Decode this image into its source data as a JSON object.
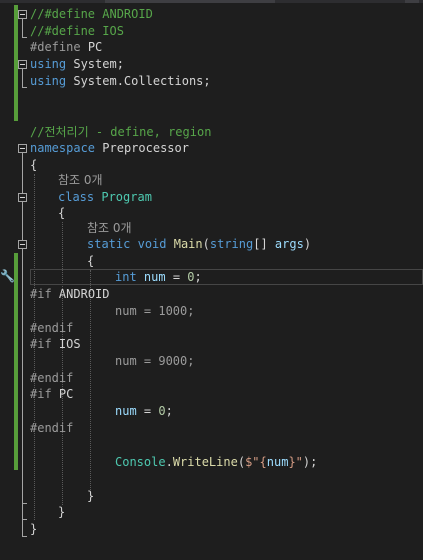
{
  "editor": {
    "lines": {
      "l1": "//#define ANDROID",
      "l2": "//#define IOS",
      "l3_directive": "#define",
      "l3_symbol": "PC",
      "l4_kw": "using",
      "l4_rest": "System;",
      "l5_kw": "using",
      "l5_rest": "System.Collections;",
      "l8_comment": "//전처리기 - define, region",
      "l9_kw": "namespace",
      "l9_name": "Preprocessor",
      "l10": "{",
      "l11_lens": "참조 0개",
      "l12_kw": "class",
      "l12_name": "Program",
      "l13": "{",
      "l14_lens": "참조 0개",
      "l15_static": "static",
      "l15_void": "void",
      "l15_method": "Main",
      "l15_paren": "(",
      "l15_type": "string",
      "l15_arr": "[] ",
      "l15_args": "args",
      "l15_close": ")",
      "l16": "{",
      "l17_int": "int",
      "l17_var": "num",
      "l17_eq": " = ",
      "l17_val": "0",
      "l17_semi": ";",
      "l18_directive": "#if",
      "l18_symbol": "ANDROID",
      "l19": "num = 1000;",
      "l20": "#endif",
      "l21_directive": "#if",
      "l21_symbol": "IOS",
      "l22": "num = 9000;",
      "l23": "#endif",
      "l24_directive": "#if",
      "l24_symbol": "PC",
      "l25_var": "num",
      "l25_eq": " = ",
      "l25_val": "0",
      "l25_semi": ";",
      "l26": "#endif",
      "l28_class": "Console",
      "l28_dot": ".",
      "l28_method": "WriteLine",
      "l28_open": "(",
      "l28_str1": "$\"{",
      "l28_var": "num",
      "l28_str2": "}\"",
      "l28_close": ");",
      "l30": "}",
      "l31": "}",
      "l32": "}"
    },
    "icons": {
      "quick_action": "wrench-icon"
    },
    "colors": {
      "background": "#1e1e1e",
      "keyword": "#569cd6",
      "type": "#4ec9b0",
      "method": "#dcdcaa",
      "variable": "#9cdcfe",
      "number": "#b5cea8",
      "string": "#d69d85",
      "comment": "#57a64a",
      "inactive": "#9b9b9b",
      "change_bar": "#579d3a"
    }
  }
}
